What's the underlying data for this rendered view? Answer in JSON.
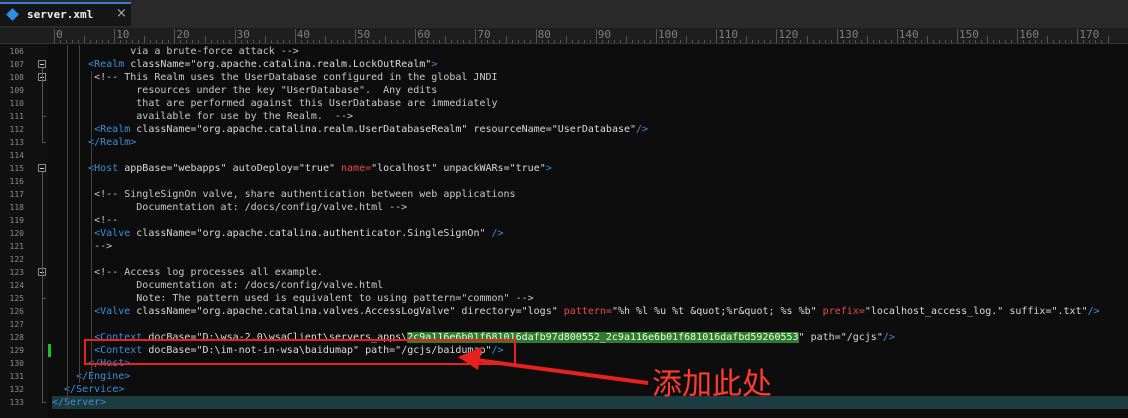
{
  "tab": {
    "title": "server.xml",
    "close": "×",
    "icon": "xml-file-icon"
  },
  "ruler": {
    "marks": [
      "0",
      "10",
      "20",
      "30",
      "40",
      "50",
      "60",
      "70",
      "80",
      "90",
      "100",
      "110",
      "120",
      "130",
      "140",
      "150",
      "160",
      "170"
    ]
  },
  "lines": [
    {
      "n": "106",
      "segs": [
        [
          "c",
          "   via a brute-force attack -->"
        ]
      ]
    },
    {
      "n": "107",
      "segs": [
        [
          "t",
          "<Realm "
        ],
        [
          "a",
          "className="
        ],
        [
          "v",
          "\"org.apache.catalina.realm.LockOutRealm\""
        ],
        [
          "t",
          ">"
        ]
      ]
    },
    {
      "n": "108",
      "segs": [
        [
          "c",
          "<!-- This Realm uses the UserDatabase configured in the global JNDI"
        ]
      ]
    },
    {
      "n": "109",
      "segs": [
        [
          "c",
          "     resources under the key \"UserDatabase\".  Any edits"
        ]
      ]
    },
    {
      "n": "110",
      "segs": [
        [
          "c",
          "     that are performed against this UserDatabase are immediately"
        ]
      ]
    },
    {
      "n": "111",
      "segs": [
        [
          "c",
          "     available for use by the Realm.  -->"
        ]
      ]
    },
    {
      "n": "112",
      "segs": [
        [
          "t",
          "<Realm "
        ],
        [
          "a",
          "className="
        ],
        [
          "v",
          "\"org.apache.catalina.realm.UserDatabaseRealm\" "
        ],
        [
          "a",
          "resourceName="
        ],
        [
          "v",
          "\"UserDatabase\""
        ],
        [
          "t",
          "/>"
        ]
      ]
    },
    {
      "n": "113",
      "segs": [
        [
          "t",
          "</Realm>"
        ]
      ]
    },
    {
      "n": "114",
      "segs": []
    },
    {
      "n": "115",
      "segs": [
        [
          "t",
          "<Host "
        ],
        [
          "a",
          "appBase="
        ],
        [
          "v",
          "\"webapps\" "
        ],
        [
          "a",
          "autoDeploy="
        ],
        [
          "v",
          "\"true\" "
        ],
        [
          "r",
          "name="
        ],
        [
          "v",
          "\"localhost\" "
        ],
        [
          "a",
          "unpackWARs="
        ],
        [
          "v",
          "\"true\""
        ],
        [
          "t",
          ">"
        ]
      ]
    },
    {
      "n": "116",
      "segs": []
    },
    {
      "n": "117",
      "segs": [
        [
          "c",
          "<!-- SingleSignOn valve, share authentication between web applications"
        ]
      ]
    },
    {
      "n": "118",
      "segs": [
        [
          "c",
          "     Documentation at: /docs/config/valve.html -->"
        ]
      ]
    },
    {
      "n": "119",
      "segs": [
        [
          "c",
          "<!--"
        ]
      ]
    },
    {
      "n": "120",
      "segs": [
        [
          "t",
          "<Valve "
        ],
        [
          "a",
          "className="
        ],
        [
          "v",
          "\"org.apache.catalina.authenticator.SingleSignOn\" "
        ],
        [
          "t",
          "/>"
        ]
      ]
    },
    {
      "n": "121",
      "segs": [
        [
          "c",
          "-->"
        ]
      ]
    },
    {
      "n": "122",
      "segs": []
    },
    {
      "n": "123",
      "segs": [
        [
          "c",
          "<!-- Access log processes all example."
        ]
      ]
    },
    {
      "n": "124",
      "segs": [
        [
          "c",
          "     Documentation at: /docs/config/valve.html"
        ]
      ]
    },
    {
      "n": "125",
      "segs": [
        [
          "c",
          "     Note: The pattern used is equivalent to using pattern=\"common\" -->"
        ]
      ]
    },
    {
      "n": "126",
      "segs": [
        [
          "t",
          "<Valve "
        ],
        [
          "a",
          "className="
        ],
        [
          "v",
          "\"org.apache.catalina.valves.AccessLogValve\" "
        ],
        [
          "a",
          "directory="
        ],
        [
          "v",
          "\"logs\" "
        ],
        [
          "r",
          "pattern="
        ],
        [
          "v",
          "\"%h %l %u %t &quot;%r&quot; %s %b\" "
        ],
        [
          "r",
          "prefix="
        ],
        [
          "v",
          "\"localhost_access_log.\" "
        ],
        [
          "a",
          "suffix="
        ],
        [
          "v",
          "\".txt\""
        ],
        [
          "t",
          "/>"
        ]
      ]
    },
    {
      "n": "127",
      "segs": []
    },
    {
      "n": "128",
      "segs": [
        [
          "t",
          "<Context "
        ],
        [
          "a",
          "docBase="
        ],
        [
          "v",
          "\"D:\\wsa-2.0\\wsaClient\\servers_apps\\"
        ],
        [
          "hl",
          "2c9a116e6b01f681016dafb97d800552_2c9a116e6b01f681016dafbd59260553"
        ],
        [
          "v",
          "\" "
        ],
        [
          "a",
          "path="
        ],
        [
          "v",
          "\"/gcjs\""
        ],
        [
          "t",
          "/>"
        ]
      ]
    },
    {
      "n": "129",
      "segs": [
        [
          "t",
          "<Context "
        ],
        [
          "a",
          "docBase="
        ],
        [
          "v",
          "\"D:\\im-not-in-wsa\\baidumap\" "
        ],
        [
          "a",
          "path="
        ],
        [
          "v",
          "\"/gcjs/baidumap\""
        ],
        [
          "t",
          "/>"
        ]
      ]
    },
    {
      "n": "130",
      "segs": [
        [
          "t",
          "</Host>"
        ]
      ]
    },
    {
      "n": "131",
      "segs": [
        [
          "t",
          "</Engine>"
        ]
      ]
    },
    {
      "n": "132",
      "segs": [
        [
          "t",
          "</Service>"
        ]
      ]
    },
    {
      "n": "133",
      "segs": [
        [
          "t",
          "</Server>"
        ]
      ]
    }
  ],
  "annotation": {
    "text": "添加此处"
  }
}
